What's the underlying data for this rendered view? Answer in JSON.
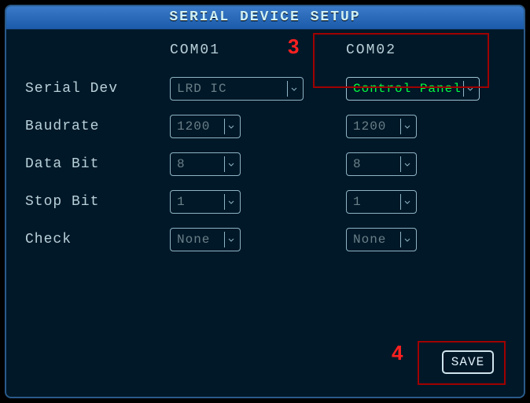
{
  "title": "SERIAL DEVICE SETUP",
  "columns": {
    "com1": "COM01",
    "com2": "COM02"
  },
  "markers": {
    "n3": "3",
    "n4": "4"
  },
  "rows": {
    "serial_dev": {
      "label": "Serial Dev",
      "com1": "LRD IC",
      "com2": "Control Panel"
    },
    "baudrate": {
      "label": "Baudrate",
      "com1": "1200",
      "com2": "1200"
    },
    "data_bit": {
      "label": "Data Bit",
      "com1": "8",
      "com2": "8"
    },
    "stop_bit": {
      "label": "Stop Bit",
      "com1": "1",
      "com2": "1"
    },
    "check": {
      "label": "Check",
      "com1": "None",
      "com2": "None"
    }
  },
  "buttons": {
    "save": "SAVE"
  }
}
